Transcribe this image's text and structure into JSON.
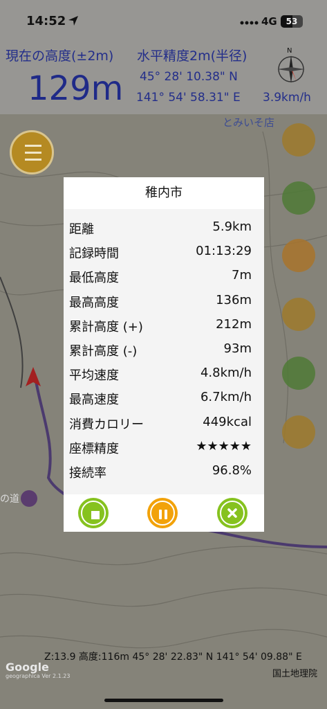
{
  "status_bar": {
    "time": "14:52",
    "network": "4G",
    "battery": "53",
    "battery_level": 0.53
  },
  "header": {
    "altitude_label": "現在の高度(±2m)",
    "altitude_value": "129m",
    "accuracy_label": "水平精度2m(半径)",
    "latitude": "45° 28' 10.38\" N",
    "longitude": "141° 54' 58.31\" E",
    "speed": "3.9km/h"
  },
  "map": {
    "shop_label": "とみいそ店",
    "poi_label": "の道",
    "footer": "Z:13.9 高度:116m  45° 28' 22.83\" N 141° 54' 09.88\" E",
    "credit": "国土地理院",
    "google": "Google",
    "google_sub": "geographica Ver 2.1.23"
  },
  "dialog": {
    "title": "稚内市",
    "rows": [
      {
        "label": "距離",
        "value": "5.9km"
      },
      {
        "label": "記録時間",
        "value": "01:13:29"
      },
      {
        "label": "最低高度",
        "value": "7m"
      },
      {
        "label": "最高高度",
        "value": "136m"
      },
      {
        "label": "累計高度 (+)",
        "value": "212m"
      },
      {
        "label": "累計高度 (-)",
        "value": "93m"
      },
      {
        "label": "平均速度",
        "value": "4.8km/h"
      },
      {
        "label": "最高速度",
        "value": "6.7km/h"
      },
      {
        "label": "消費カロリー",
        "value": "449kcal"
      },
      {
        "label": "座標精度",
        "value": "★★★★★"
      },
      {
        "label": "接続率",
        "value": "96.8%"
      }
    ],
    "buttons": {
      "stop": "stop-icon",
      "pause": "pause-icon",
      "close": "close-icon"
    }
  },
  "colors": {
    "stop": "#86c21f",
    "pause": "#f2a20a",
    "header_text": "#232e8a",
    "menu": "#b58a22"
  }
}
